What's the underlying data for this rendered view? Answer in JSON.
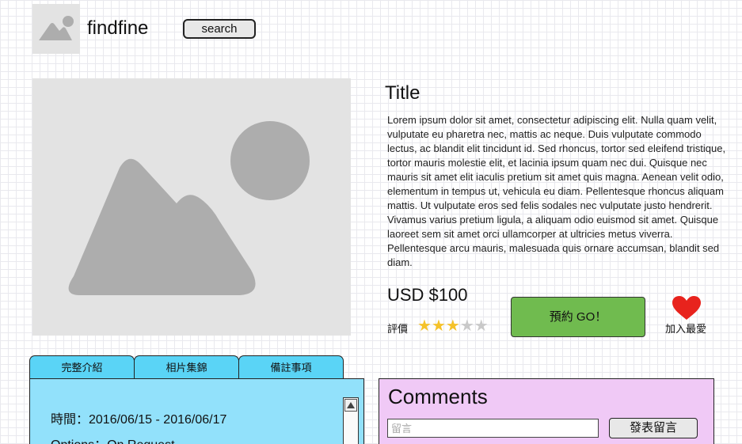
{
  "header": {
    "brand": "findfine",
    "search_label": "search",
    "logo_icon": "image-placeholder-icon"
  },
  "product": {
    "image_icon": "image-placeholder-icon",
    "title": "Title",
    "description": "Lorem ipsum dolor sit amet, consectetur adipiscing elit. Nulla quam velit, vulputate eu pharetra nec, mattis ac neque. Duis vulputate commodo lectus, ac blandit elit tincidunt id. Sed rhoncus, tortor sed eleifend tristique, tortor mauris molestie elit, et lacinia ipsum quam nec dui. Quisque nec mauris sit amet elit iaculis pretium sit amet quis magna. Aenean velit odio, elementum in tempus ut, vehicula eu diam. Pellentesque rhoncus aliquam mattis. Ut vulputate eros sed felis sodales nec vulputate justo hendrerit. Vivamus varius pretium ligula, a aliquam odio euismod sit amet. Quisque laoreet sem sit amet orci ullamcorper at ultricies metus viverra. Pellentesque arcu mauris, malesuada quis ornare accumsan, blandit sed diam.",
    "price": "USD $100",
    "rating_label": "評價",
    "rating_value": 3,
    "rating_max": 5,
    "book_label": "預約 GO！",
    "favorite_label": "加入最愛",
    "favorite_icon": "heart-icon"
  },
  "tabs": [
    {
      "label": "完整介紹"
    },
    {
      "label": "相片集錦"
    },
    {
      "label": "備註事項"
    }
  ],
  "info": {
    "time": "時間：2016/06/15 - 2016/06/17",
    "options": "Options：On Request"
  },
  "comments": {
    "title": "Comments",
    "placeholder": "留言",
    "post_label": "發表留言"
  },
  "colors": {
    "go_button": "#70bb4f",
    "tab": "#5ad4f6",
    "tab_panel": "#92e1fb",
    "comments_panel": "#f0c9f6",
    "star_filled": "#f5c22a",
    "heart": "#e8231d"
  }
}
